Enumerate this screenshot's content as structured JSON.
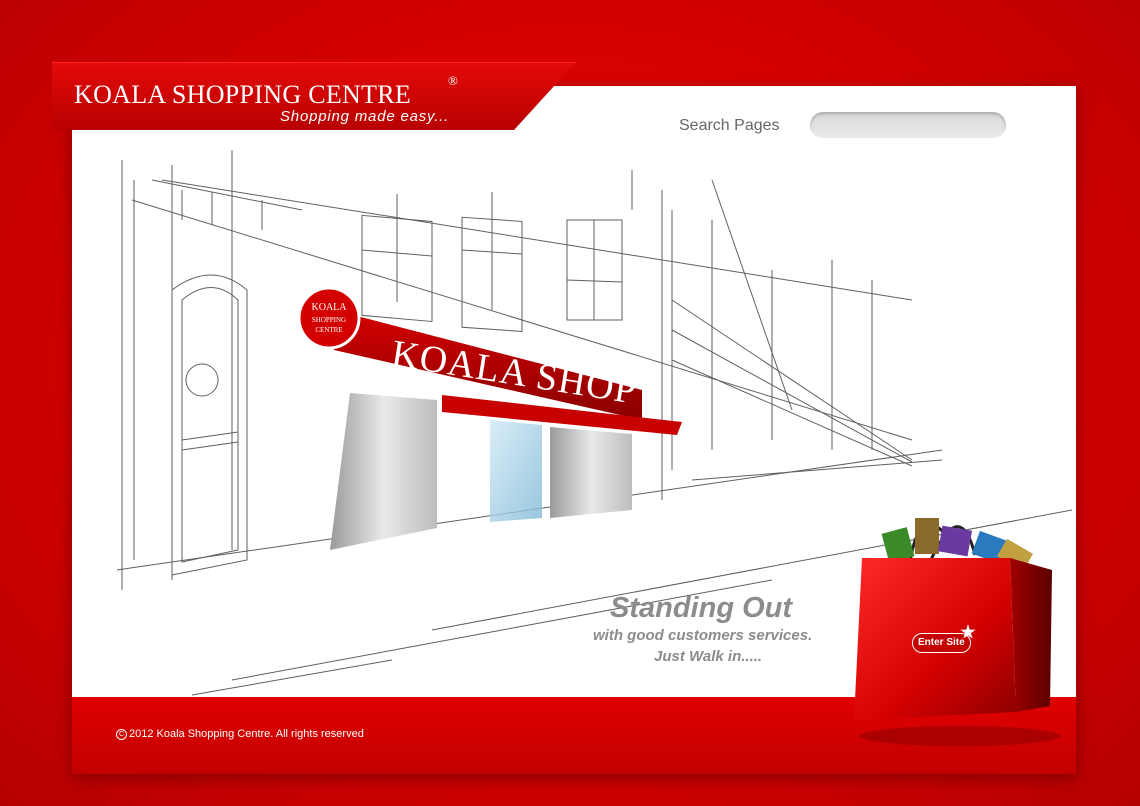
{
  "brand": {
    "name": "KOALA SHOPPING CENTRE",
    "registered_mark": "®",
    "tagline": "Shopping made easy...",
    "color_primary": "#d60000"
  },
  "search": {
    "label": "Search Pages",
    "value": "",
    "placeholder": ""
  },
  "hero": {
    "sign_round": [
      "KOALA",
      "SHOPPING",
      "CENTRE"
    ],
    "awning_text": "KOALA SHOP",
    "headline": "Standing Out",
    "subline_1": "with good customers services.",
    "subline_2": "Just Walk in.....",
    "illustration_icon": "storefront-sketch"
  },
  "bag": {
    "icon": "shopping-bag",
    "button_label": "Enter Site"
  },
  "footer": {
    "copyright_symbol": "C",
    "copyright_text": "2012 Koala Shopping Centre. All rights reserved"
  }
}
